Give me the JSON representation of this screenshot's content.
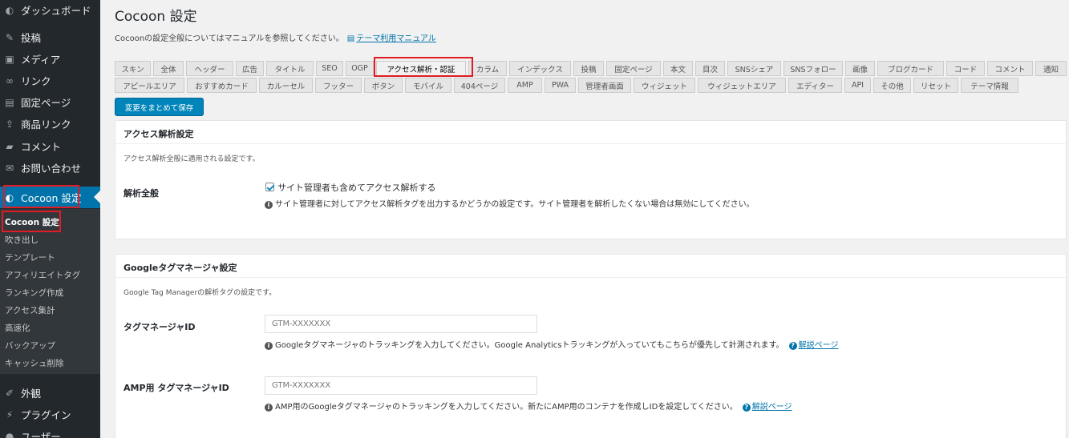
{
  "sidebar": {
    "items": [
      {
        "label": "ダッシュボード",
        "icon": "dashboard-icon",
        "glyph": "◐"
      },
      {
        "label": "投稿",
        "icon": "pin-icon",
        "glyph": "✎"
      },
      {
        "label": "メディア",
        "icon": "media-icon",
        "glyph": "▣"
      },
      {
        "label": "リンク",
        "icon": "link-icon",
        "glyph": "∞"
      },
      {
        "label": "固定ページ",
        "icon": "page-icon",
        "glyph": "▤"
      },
      {
        "label": "商品リンク",
        "icon": "product-link-icon",
        "glyph": "⇪"
      },
      {
        "label": "コメント",
        "icon": "comment-icon",
        "glyph": "▰"
      },
      {
        "label": "お問い合わせ",
        "icon": "mail-icon",
        "glyph": "✉"
      },
      {
        "label": "Cocoon 設定",
        "icon": "cocoon-icon",
        "glyph": "◐"
      },
      {
        "label": "外観",
        "icon": "appearance-icon",
        "glyph": "✐"
      },
      {
        "label": "プラグイン",
        "icon": "plugin-icon",
        "glyph": "⚡"
      },
      {
        "label": "ユーザー",
        "icon": "user-icon",
        "glyph": "●"
      }
    ],
    "submenu": [
      "Cocoon 設定",
      "吹き出し",
      "テンプレート",
      "アフィリエイトタグ",
      "ランキング作成",
      "アクセス集計",
      "高速化",
      "バックアップ",
      "キャッシュ削除"
    ]
  },
  "page": {
    "title": "Cocoon 設定",
    "intro": "Cocoonの設定全般についてはマニュアルを参照してください。",
    "manual_link": "テーマ利用マニュアル"
  },
  "tabs_row1": [
    "スキン",
    "全体",
    "ヘッダー",
    "広告",
    "タイトル",
    "SEO",
    "OGP",
    "アクセス解析・認証",
    "カラム",
    "インデックス",
    "投稿",
    "固定ページ",
    "本文",
    "目次",
    "SNSシェア",
    "SNSフォロー",
    "画像",
    "ブログカード",
    "コード",
    "コメント",
    "通知"
  ],
  "tabs_row2": [
    "アピールエリア",
    "おすすめカード",
    "カルーセル",
    "フッター",
    "ボタン",
    "モバイル",
    "404ページ",
    "AMP",
    "PWA",
    "管理者画面",
    "ウィジェット",
    "ウィジェットエリア",
    "エディター",
    "API",
    "その他",
    "リセット",
    "テーマ情報"
  ],
  "save_label": "変更をまとめて保存",
  "access_panel": {
    "title": "アクセス解析設定",
    "desc": "アクセス解析全般に適用される設定です。",
    "row_label": "解析全般",
    "checkbox_label": "サイト管理者も含めてアクセス解析する",
    "checkbox_checked": true,
    "help": "サイト管理者に対してアクセス解析タグを出力するかどうかの設定です。サイト管理者を解析したくない場合は無効にしてください。"
  },
  "gtm_panel": {
    "title": "Googleタグマネージャ設定",
    "desc": "Google Tag Managerの解析タグの設定です。",
    "row1_label": "タグマネージャID",
    "row1_placeholder": "GTM-XXXXXXX",
    "row1_help": "Googleタグマネージャのトラッキングを入力してください。Google Analyticsトラッキングが入っていてもこちらが優先して計測されます。",
    "row1_help_text": "Googleタグマネージャのトラッキングを入力してください。Google Analyticsトラッキングが入っていてもこちらが優先して計測されます。",
    "row1_link": "解説ページ",
    "row2_label": "AMP用 タグマネージャID",
    "row2_placeholder": "GTM-XXXXXXX",
    "row2_help": "AMP用のGoogleタグマネージャのトラッキングを入力してください。新たにAMP用のコンテナを作成しIDを設定してください。",
    "row2_link": "解説ページ"
  }
}
